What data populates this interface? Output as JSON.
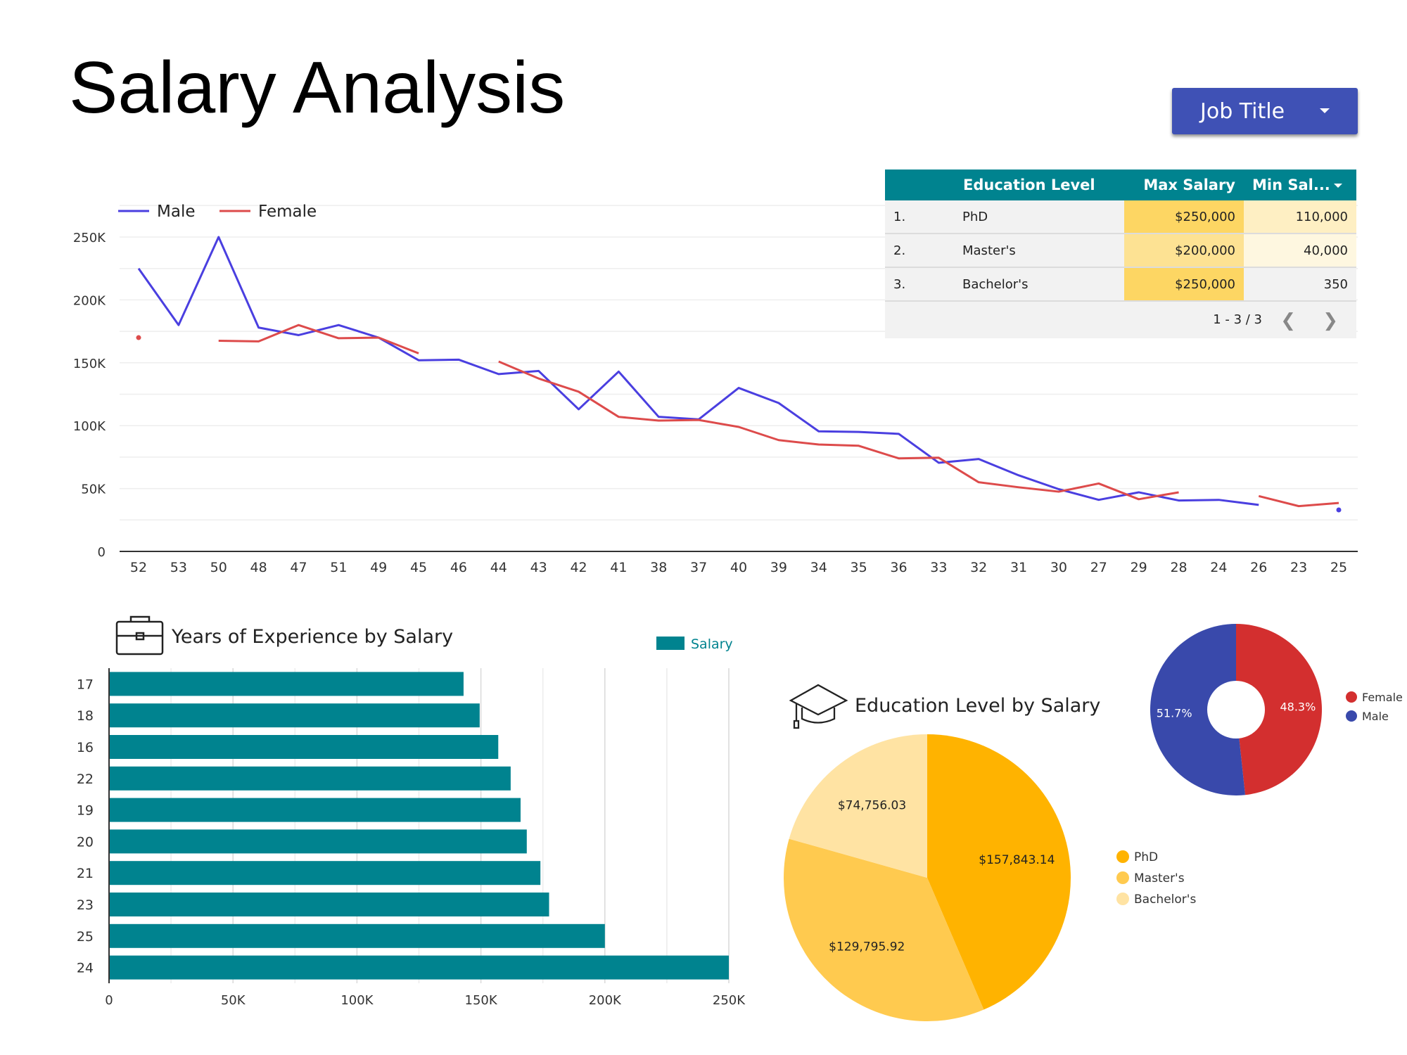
{
  "page": {
    "title": "Salary Analysis"
  },
  "filter": {
    "label": "Job Title",
    "caret_icon": "dropdown-caret-icon"
  },
  "table": {
    "headers": {
      "education": "Education Level",
      "max": "Max Salary",
      "min": "Min Sal..."
    },
    "rows": [
      {
        "idx": "1.",
        "education": "PhD",
        "max": "$250,000",
        "min": "110,000"
      },
      {
        "idx": "2.",
        "education": "Master's",
        "max": "$200,000",
        "min": "40,000"
      },
      {
        "idx": "3.",
        "education": "Bachelor's",
        "max": "$250,000",
        "min": "350"
      }
    ],
    "pager": {
      "range": "1 - 3 / 3",
      "prev_icon": "chevron-left-icon",
      "next_icon": "chevron-right-icon"
    },
    "colors": {
      "header": "#00838f",
      "max_strong": "#fdd663",
      "max_mid": "#fde293",
      "min_mid": "#feefc3",
      "min_light": "#fef7e0"
    }
  },
  "chart_data": [
    {
      "type": "line",
      "title": "",
      "xlabel": "",
      "ylabel": "",
      "categories": [
        "52",
        "53",
        "50",
        "48",
        "47",
        "51",
        "49",
        "45",
        "46",
        "44",
        "43",
        "42",
        "41",
        "38",
        "37",
        "40",
        "39",
        "34",
        "35",
        "36",
        "33",
        "32",
        "31",
        "30",
        "27",
        "29",
        "28",
        "24",
        "26",
        "23",
        "25"
      ],
      "series": [
        {
          "name": "Male",
          "color": "#4a3fe0",
          "values": [
            225000,
            180000,
            250000,
            178000,
            172000,
            180000,
            170000,
            152000,
            152500,
            141000,
            143500,
            113000,
            143000,
            107000,
            105000,
            130000,
            118000,
            95500,
            95000,
            93500,
            70500,
            73500,
            60500,
            49500,
            41000,
            47000,
            40500,
            41000,
            37000,
            null,
            33000
          ]
        },
        {
          "name": "Female",
          "color": "#dd4b4b",
          "values": [
            170000,
            null,
            167500,
            167000,
            180000,
            169500,
            170000,
            157500,
            null,
            151000,
            137500,
            127000,
            107000,
            104000,
            104500,
            99000,
            88500,
            85000,
            84000,
            74000,
            74500,
            55000,
            51000,
            47500,
            54000,
            41500,
            47000,
            null,
            44000,
            36000,
            38500
          ]
        }
      ],
      "ylim": [
        0,
        250000
      ],
      "yticks": [
        0,
        50000,
        100000,
        150000,
        200000,
        250000
      ],
      "ytick_labels": [
        "0",
        "50K",
        "100K",
        "150K",
        "200K",
        "250K"
      ],
      "grid": true,
      "legend": "top-left"
    },
    {
      "type": "bar",
      "orientation": "horizontal",
      "title": "Years of Experience by Salary",
      "icon": "briefcase-icon",
      "categories": [
        "17",
        "18",
        "16",
        "22",
        "19",
        "20",
        "21",
        "23",
        "25",
        "24"
      ],
      "series": [
        {
          "name": "Salary",
          "color": "#00838f",
          "values": [
            143000,
            149500,
            157000,
            162000,
            166000,
            168500,
            174000,
            177500,
            200000,
            250000
          ]
        }
      ],
      "xlim": [
        0,
        250000
      ],
      "xticks": [
        0,
        50000,
        100000,
        150000,
        200000,
        250000
      ],
      "xtick_labels": [
        "0",
        "50K",
        "100K",
        "150K",
        "200K",
        "250K"
      ],
      "grid": true,
      "legend": "top-right"
    },
    {
      "type": "pie",
      "title": "Education Level by Salary",
      "icon": "graduation-cap-icon",
      "slices": [
        {
          "name": "PhD",
          "value": 157843.14,
          "label": "$157,843.14",
          "color": "#ffb300"
        },
        {
          "name": "Master's",
          "value": 129795.92,
          "label": "$129,795.92",
          "color": "#ffca4f"
        },
        {
          "name": "Bachelor's",
          "value": 74756.03,
          "label": "$74,756.03",
          "color": "#ffe3a3"
        }
      ],
      "legend": "right"
    },
    {
      "type": "pie",
      "donut": true,
      "title": "",
      "slices": [
        {
          "name": "Female",
          "value": 48.3,
          "label": "48.3%",
          "color": "#d32f2f"
        },
        {
          "name": "Male",
          "value": 51.7,
          "label": "51.7%",
          "color": "#3949ab"
        }
      ],
      "legend": "right"
    }
  ]
}
